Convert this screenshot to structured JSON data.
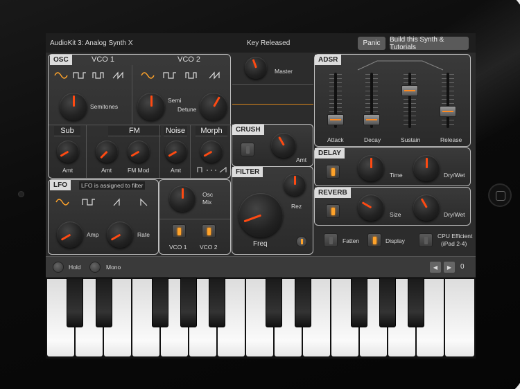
{
  "header": {
    "app_title": "AudioKit 3: Analog Synth X",
    "status": "Key Released",
    "panic_label": "Panic",
    "build_label": "Build this Synth & Tutorials"
  },
  "osc": {
    "label": "OSC",
    "vco1_label": "VCO 1",
    "vco2_label": "VCO 2",
    "semitones_label": "Semitones",
    "semi_label": "Semi",
    "detune_label": "Detune",
    "waveforms": [
      "sine",
      "square",
      "pulse",
      "saw"
    ]
  },
  "sub": {
    "label": "Sub",
    "amt_label": "Amt"
  },
  "fm": {
    "label": "FM",
    "amt_label": "Amt",
    "mod_label": "FM Mod"
  },
  "noise": {
    "label": "Noise",
    "amt_label": "Amt"
  },
  "morph": {
    "label": "Morph"
  },
  "master": {
    "label": "Master"
  },
  "crush": {
    "label": "CRUSH",
    "amt_label": "Amt"
  },
  "filter": {
    "label": "FILTER",
    "freq_label": "Freq",
    "rez_label": "Rez"
  },
  "lfo": {
    "label": "LFO",
    "note": "LFO is assigned to filter",
    "amp_label": "Amp",
    "rate_label": "Rate",
    "osc_mix_label_1": "Osc",
    "osc_mix_label_2": "Mix",
    "vco1_label": "VCO 1",
    "vco2_label": "VCO 2"
  },
  "adsr": {
    "label": "ADSR",
    "attack_label": "Attack",
    "decay_label": "Decay",
    "sustain_label": "Sustain",
    "release_label": "Release"
  },
  "delay": {
    "label": "DELAY",
    "time_label": "Time",
    "drywet_label": "Dry/Wet"
  },
  "reverb": {
    "label": "REVERB",
    "size_label": "Size",
    "drywet_label": "Dry/Wet"
  },
  "bottom_toggles": {
    "fatten_label": "Fatten",
    "display_label": "Display",
    "cpu_label_1": "CPU Efficient",
    "cpu_label_2": "(iPad 2-4)"
  },
  "keyboard_bar": {
    "hold_label": "Hold",
    "mono_label": "Mono",
    "octave_value": "0",
    "prev_icon": "◀",
    "next_icon": "▶"
  },
  "colors": {
    "accent": "#ff4a12",
    "led": "#ffa32a",
    "panel_border": "#bfbfbf"
  }
}
